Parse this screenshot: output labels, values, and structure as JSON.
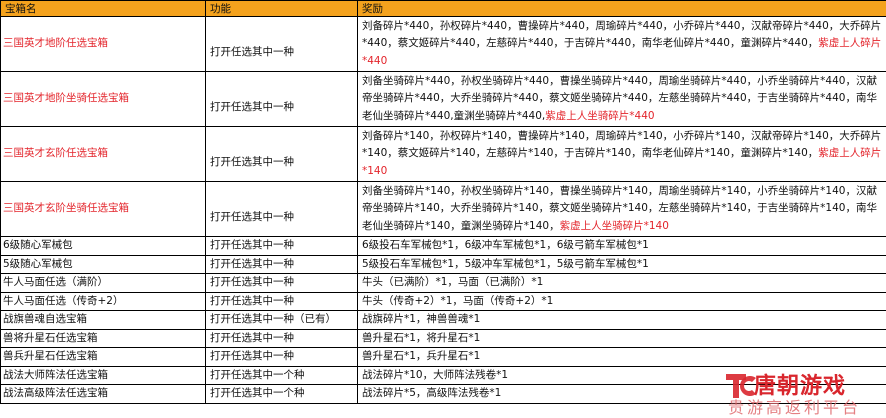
{
  "header": {
    "col_name": "宝箱名",
    "col_func": "功能",
    "col_reward": "奖励"
  },
  "rows": [
    {
      "name": "三国英才地阶任选宝箱",
      "func": "打开任选其中一种",
      "reward": "刘备碎片*440，孙权碎片*440，曹操碎片*440，周瑜碎片*440，小乔碎片*440，汉献帝碎片*440，大乔碎片*440，蔡文姬碎片*440，左慈碎片*440，于吉碎片*440，南华老仙碎片*440，童渊碎片*440，",
      "reward_hl": "紫虚上人碎片*440"
    },
    {
      "name": "三国英才地阶坐骑任选宝箱",
      "func": "打开任选其中一种",
      "reward": "刘备坐骑碎片*440，孙权坐骑碎片*440，曹操坐骑碎片*440，周瑜坐骑碎片*440，小乔坐骑碎片*440，汉献帝坐骑碎片*440，大乔坐骑碎片*440，蔡文姬坐骑碎片*440，左慈坐骑碎片*440，于吉坐骑碎片*440，南华老仙坐骑碎片*440,童渊坐骑碎片*440,",
      "reward_hl": "紫虚上人坐骑碎片*440"
    },
    {
      "name": "三国英才玄阶任选宝箱",
      "func": "打开任选其中一种",
      "reward": "刘备碎片*140，孙权碎片*140，曹操碎片*140，周瑜碎片*140，小乔碎片*140，汉献帝碎片*140，大乔碎片*140，蔡文姬碎片*140，左慈碎片*140，于吉碎片*140，南华老仙碎片*140，童渊碎片*140，",
      "reward_hl": "紫虚上人碎片*140"
    },
    {
      "name": "三国英才玄阶坐骑任选宝箱",
      "func": "打开任选其中一种",
      "reward": "刘备坐骑碎片*140，孙权坐骑碎片*140，曹操坐骑碎片*140，周瑜坐骑碎片*140，小乔坐骑碎片*140，汉献帝坐骑碎片*140，大乔坐骑碎片*140，蔡文姬坐骑碎片*140，左慈坐骑碎片*140，于吉坐骑碎片*140，南华老仙坐骑碎片*140，童渊坐骑碎片*140，",
      "reward_hl": "紫虚上人坐骑碎片*140"
    },
    {
      "name": "6级随心军械包",
      "func": "打开任选其中一种",
      "reward": "6级投石车军械包*1，6级冲车军械包*1，6级弓箭车军械包*1",
      "reward_hl": ""
    },
    {
      "name": "5级随心军械包",
      "func": "打开任选其中一种",
      "reward": "5级投石车军械包*1，5级冲车军械包*1，5级弓箭车军械包*1",
      "reward_hl": ""
    },
    {
      "name": "牛人马面任选（满阶）",
      "func": "打开任选其中一种",
      "reward": "牛头（已满阶）*1，马面（已满阶）*1",
      "reward_hl": ""
    },
    {
      "name": "牛人马面任选（传奇+2）",
      "func": "打开任选其中一种",
      "reward": "牛头（传奇+2）*1，马面（传奇+2）*1",
      "reward_hl": ""
    },
    {
      "name": "战旗兽魂自选宝箱",
      "func": "打开任选其中一种（已有）",
      "reward": "战旗碎片*1，神兽兽魂*1",
      "reward_hl": ""
    },
    {
      "name": "兽将升星石任选宝箱",
      "func": "打开任选其中一种",
      "reward": "兽升星石*1，将升星石*1",
      "reward_hl": ""
    },
    {
      "name": "兽兵升星石任选宝箱",
      "func": "打开任选其中一种",
      "reward": "兽升星石*1，兵升星石*1",
      "reward_hl": ""
    },
    {
      "name": "战法大师阵法任选宝箱",
      "func": "打开任选其中一个种",
      "reward": "战法碎片*10，大师阵法残卷*1",
      "reward_hl": ""
    },
    {
      "name": "战法高级阵法任选宝箱",
      "func": "打开任选其中一个种",
      "reward": "战法碎片*5，高级阵法残卷*1",
      "reward_hl": ""
    }
  ],
  "watermark": {
    "brand": "唐朝游戏",
    "slogan": "贵游高返利平台",
    "logo_text": "TC"
  }
}
